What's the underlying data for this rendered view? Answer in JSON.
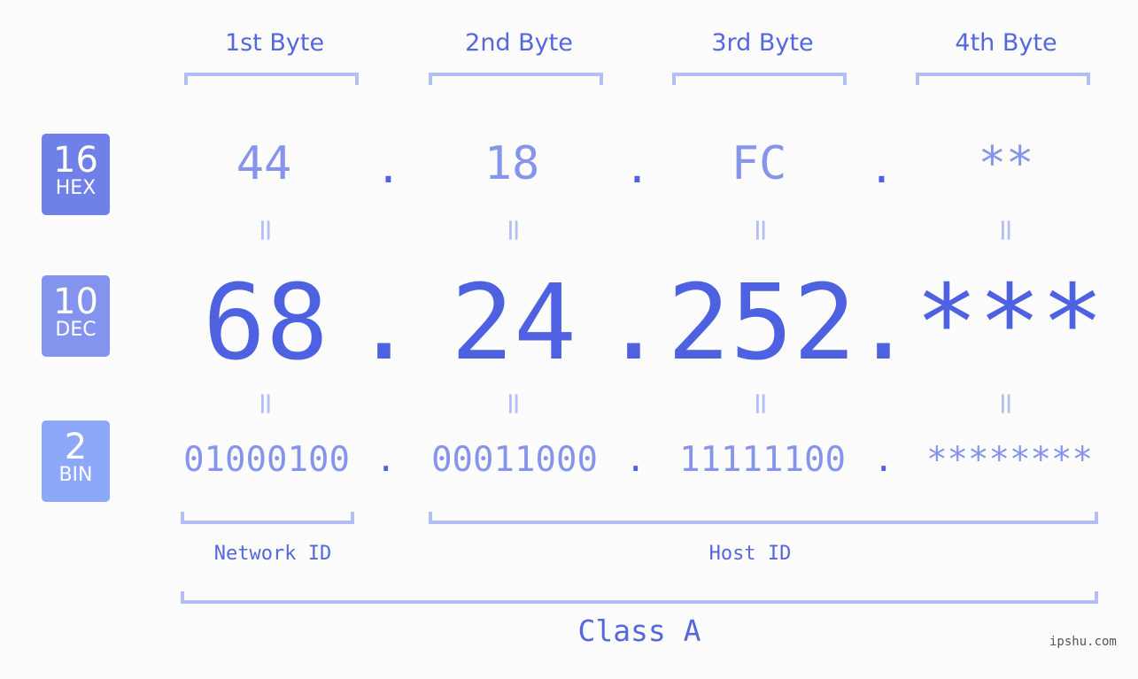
{
  "byte_headers": [
    "1st Byte",
    "2nd Byte",
    "3rd Byte",
    "4th Byte"
  ],
  "badges": [
    {
      "base": "16",
      "label": "HEX",
      "color": "#6f80e8"
    },
    {
      "base": "10",
      "label": "DEC",
      "color": "#8494ee"
    },
    {
      "base": "2",
      "label": "BIN",
      "color": "#8da8f8"
    }
  ],
  "hex": [
    "44",
    "18",
    "FC",
    "**"
  ],
  "dec": [
    "68",
    "24",
    "252",
    "***"
  ],
  "bin": [
    "01000100",
    "00011000",
    "11111100",
    "********"
  ],
  "separator": ".",
  "equals": "=",
  "network_id_label": "Network ID",
  "host_id_label": "Host ID",
  "class_label": "Class A",
  "watermark": "ipshu.com",
  "colors": {
    "accent": "#4e62e1",
    "light": "#8794ec",
    "bracket": "#b3bef6"
  }
}
